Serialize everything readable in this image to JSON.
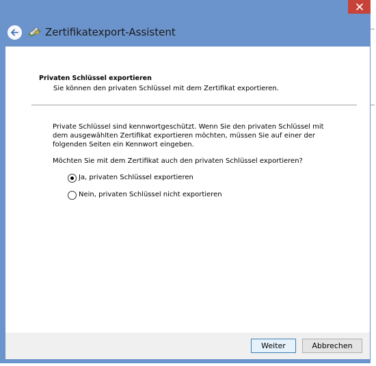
{
  "window": {
    "title": "Zertifikatexport-Assistent"
  },
  "header": {
    "heading": "Privaten Schlüssel exportieren",
    "subheading": "Sie können den privaten Schlüssel mit dem Zertifikat exportieren."
  },
  "body": {
    "description": "Private Schlüssel sind kennwortgeschützt. Wenn Sie den privaten Schlüssel mit dem ausgewählten Zertifikat exportieren möchten, müssen Sie auf einer der folgenden Seiten ein Kennwort eingeben.",
    "question": "Möchten Sie mit dem Zertifikat auch den privaten Schlüssel exportieren?",
    "options": [
      {
        "label": "Ja, privaten Schlüssel exportieren",
        "selected": true
      },
      {
        "label": "Nein, privaten Schlüssel nicht exportieren",
        "selected": false
      }
    ]
  },
  "footer": {
    "next_label": "Weiter",
    "cancel_label": "Abbrechen"
  },
  "colors": {
    "title_bar": "#6b93cc",
    "close_button": "#c7433a",
    "footer": "#f0f0f0",
    "default_button_border": "#3c7fb1"
  },
  "icons": {
    "back": "back-arrow-icon",
    "app": "certificate-icon",
    "close": "close-icon"
  }
}
